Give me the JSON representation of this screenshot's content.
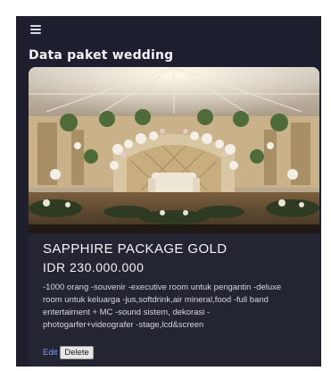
{
  "header": {
    "menu_icon": "hamburger-menu-icon",
    "title": "Data paket wedding"
  },
  "packages": [
    {
      "name": "SAPPHIRE PACKAGE GOLD",
      "price": "IDR 230.000.000",
      "description": "-1000 orang -souvenir -executive room untuk pengantin -deluxe room untuk keluarga -jus,softdrink,air mineral,food -full band entertaiment + MC -sound sistem, dekorasi -photogarfer+videografer -stage,lcd&screen",
      "edit_label": "Edit",
      "delete_label": "Delete"
    }
  ],
  "colors": {
    "background": "#1e1f2e",
    "card": "#242533",
    "link": "#7ea0e6",
    "text": "#f3f3f6"
  }
}
